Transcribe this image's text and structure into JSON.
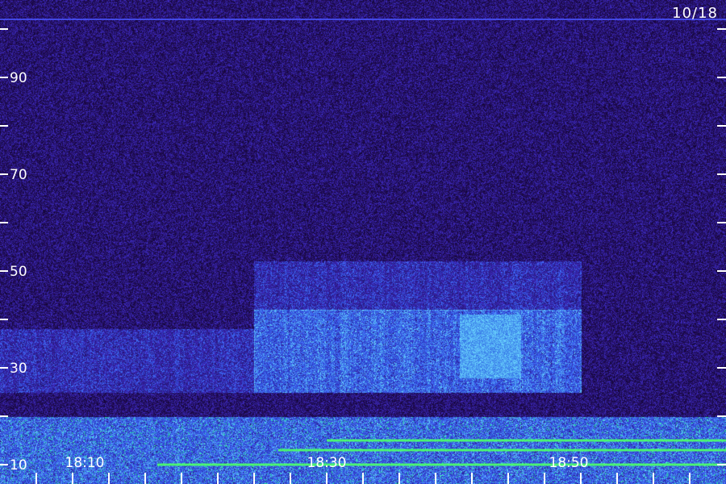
{
  "date_label": "10/18",
  "colors": {
    "background": "#1c0c4e",
    "noise_low": "#120838",
    "noise_mid": "#2a1c8a",
    "noise_high": "#3a3ad8",
    "band_green": "#4cff6a",
    "tick": "#ffffff"
  },
  "chart_data": {
    "type": "heatmap",
    "title": "",
    "xlabel": "",
    "ylabel": "",
    "y_range": [
      6,
      106
    ],
    "x_range": [
      "18:03",
      "19:03"
    ],
    "y_ticks_major": [
      10,
      30,
      50,
      70,
      90
    ],
    "y_tick_labels": [
      "10",
      "30",
      "50",
      "70",
      "90"
    ],
    "y_ticks_minor": [
      20,
      40,
      60,
      80,
      100
    ],
    "x_ticks": [
      "18:06",
      "18:09",
      "18:12",
      "18:15",
      "18:18",
      "18:21",
      "18:24",
      "18:27",
      "18:30",
      "18:33",
      "18:36",
      "18:39",
      "18:42",
      "18:45",
      "18:48",
      "18:51",
      "18:54",
      "18:57",
      "19:00"
    ],
    "x_tick_labels": [
      {
        "time": "18:10",
        "label": "18:10"
      },
      {
        "time": "18:30",
        "label": "18:30"
      },
      {
        "time": "18:50",
        "label": "18:50"
      }
    ],
    "intensity_regions": [
      {
        "y_from": 25,
        "y_to": 42,
        "x_from": "18:24",
        "x_to": "18:51",
        "level": "medium"
      },
      {
        "y_from": 28,
        "y_to": 41,
        "x_from": "18:41",
        "x_to": "18:46",
        "level": "high"
      },
      {
        "y_from": 42,
        "y_to": 52,
        "x_from": "18:24",
        "x_to": "18:51",
        "level": "low"
      },
      {
        "y_from": 25,
        "y_to": 38,
        "x_from": "18:03",
        "x_to": "18:24",
        "level": "low"
      }
    ],
    "lines": [
      {
        "y": 10,
        "x_from": "18:16",
        "x_to": "19:03",
        "color": "green"
      },
      {
        "y": 13,
        "x_from": "18:26",
        "x_to": "19:03",
        "color": "green"
      },
      {
        "y": 15,
        "x_from": "18:30",
        "x_to": "19:03",
        "color": "green"
      },
      {
        "y": 102,
        "x_from": "18:03",
        "x_to": "19:03",
        "color": "blue"
      }
    ],
    "grid": false
  }
}
